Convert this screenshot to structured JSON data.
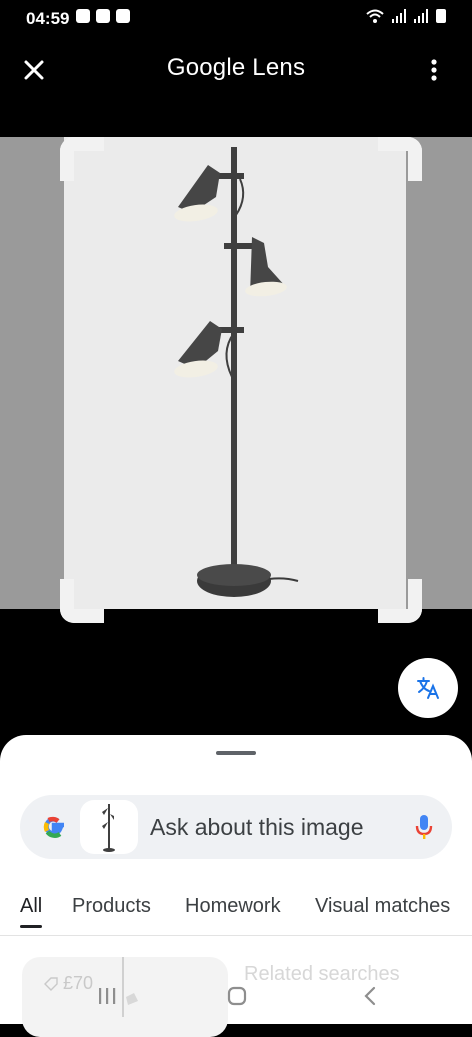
{
  "status": {
    "time": "04:59"
  },
  "header": {
    "title": "Google Lens"
  },
  "search": {
    "prompt": "Ask about this image"
  },
  "tabs": [
    {
      "label": "All"
    },
    {
      "label": "Products"
    },
    {
      "label": "Homework"
    },
    {
      "label": "Visual matches"
    }
  ],
  "results": {
    "price": "£70",
    "related": "Related searches"
  },
  "icons": [
    "close-icon",
    "more-vert-icon",
    "translate-icon",
    "google-logo-icon",
    "mic-icon",
    "back-icon",
    "home-icon",
    "recents-icon",
    "price-tag-icon"
  ],
  "colors": {
    "lamp": "#3f3f3f",
    "accent_blue": "#4285f4",
    "accent_red": "#ea4335",
    "accent_yellow": "#fbbc05",
    "accent_green": "#34a853"
  }
}
